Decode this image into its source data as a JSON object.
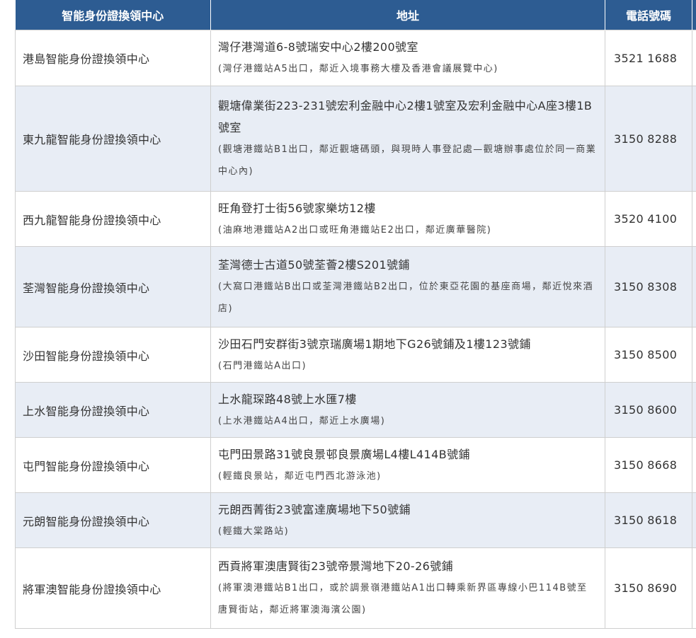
{
  "header": {
    "col_center": "智能身份證換領中心",
    "col_address": "地址",
    "col_phone": "電話號碼"
  },
  "rows": [
    {
      "center": "港島智能身份證換領中心",
      "address": "灣仔港灣道6-8號瑞安中心2樓200號室",
      "note": "(灣仔港鐵站A5出口，鄰近入境事務大樓及香港會議展覽中心)",
      "phone": "3521 1688"
    },
    {
      "center": "東九龍智能身份證換領中心",
      "address": "觀塘偉業街223-231號宏利金融中心2樓1號室及宏利金融中心A座3樓1B號室",
      "note": "(觀塘港鐵站B1出口，鄰近觀塘碼頭，與現時人事登記處—觀塘辦事處位於同一商業中心內)",
      "phone": "3150 8288"
    },
    {
      "center": "西九龍智能身份證換領中心",
      "address": "旺角登打士街56號家樂坊12樓",
      "note": "(油麻地港鐵站A2出口或旺角港鐵站E2出口，鄰近廣華醫院)",
      "phone": "3520 4100"
    },
    {
      "center": "荃灣智能身份證換領中心",
      "address": "荃灣德士古道50號荃薈2樓S201號鋪",
      "note": "(大窩口港鐵站B出口或荃灣港鐵站B2出口，位於東亞花園的基座商場，鄰近悅來酒店)",
      "phone": "3150 8308"
    },
    {
      "center": "沙田智能身份證換領中心",
      "address": "沙田石門安群街3號京瑞廣場1期地下G26號鋪及1樓123號鋪",
      "note": "(石門港鐵站A出口)",
      "phone": "3150 8500"
    },
    {
      "center": "上水智能身份證換領中心",
      "address": "上水龍琛路48號上水匯7樓",
      "note": "(上水港鐵站A4出口，鄰近上水廣場)",
      "phone": "3150 8600"
    },
    {
      "center": "屯門智能身份證換領中心",
      "address": "屯門田景路31號良景邨良景廣場L4樓L414B號鋪",
      "note": "(輕鐵良景站，鄰近屯門西北游泳池)",
      "phone": "3150 8668"
    },
    {
      "center": "元朗智能身份證換領中心",
      "address": "元朗西菁街23號富達廣場地下50號鋪",
      "note": "(輕鐵大棠路站)",
      "phone": "3150 8618"
    },
    {
      "center": "將軍澳智能身份證換領中心",
      "address": "西貢將軍澳唐賢街23號帝景灣地下20-26號鋪",
      "note": "(將軍澳港鐵站B1出口，或於調景嶺港鐵站A1出口轉乘新界區專線小巴114B號至唐賢街站，鄰近將軍澳海濱公園)",
      "phone": "3150 8690"
    }
  ]
}
